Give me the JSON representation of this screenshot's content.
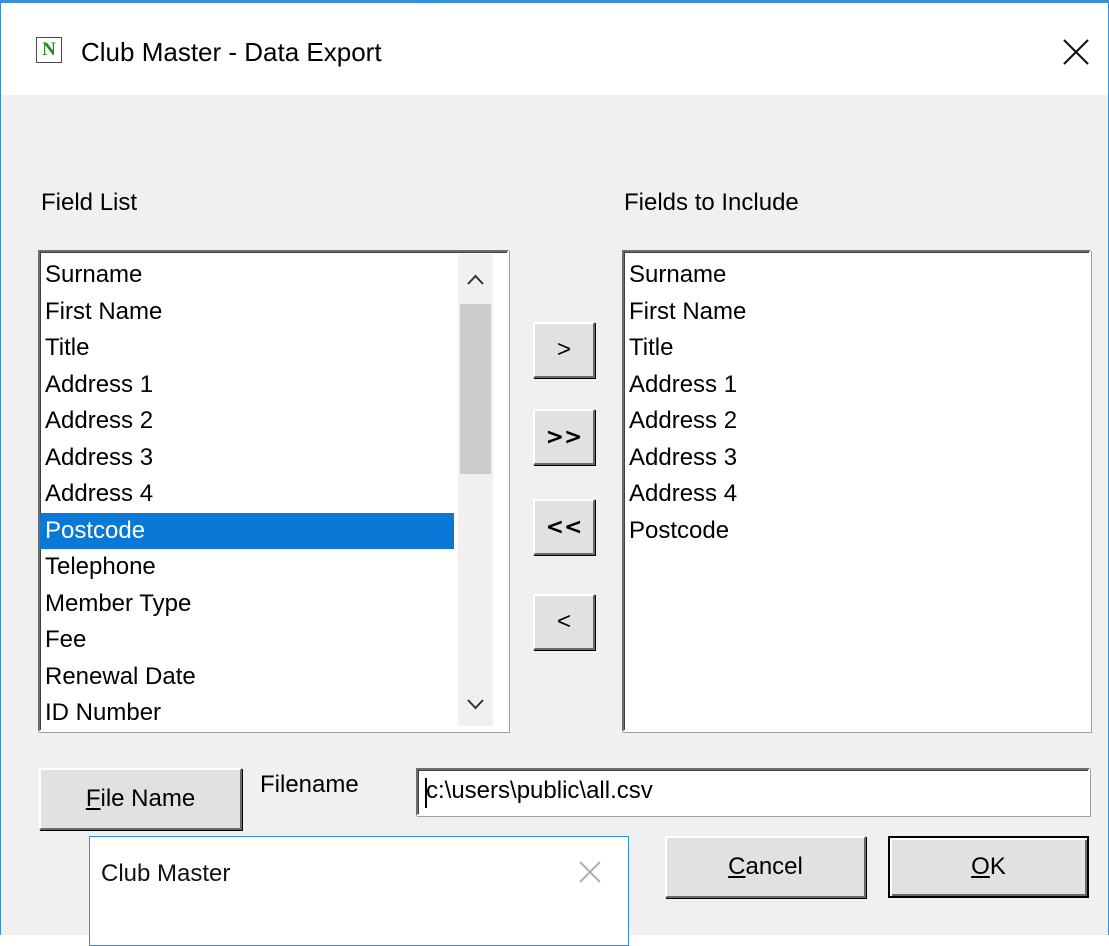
{
  "window": {
    "title": "Club Master - Data Export",
    "app_icon_letter": "N",
    "app_icon": "app-n-icon",
    "close_icon": "close-icon",
    "accent_color": "#3b8fd6"
  },
  "field_list": {
    "label": "Field List",
    "items": [
      "Surname",
      "First Name",
      "Title",
      "Address 1",
      "Address 2",
      "Address 3",
      "Address 4",
      "Postcode",
      "Telephone",
      "Member Type",
      "Fee",
      "Renewal Date",
      "ID Number"
    ],
    "selected_item": "Postcode",
    "selection_color": "#0a78d7",
    "scrollbar": {
      "up_icon": "chevron-up-icon",
      "down_icon": "chevron-down-icon"
    }
  },
  "fields_to_include": {
    "label": "Fields to Include",
    "items": [
      "Surname",
      "First Name",
      "Title",
      "Address 1",
      "Address 2",
      "Address 3",
      "Address 4",
      "Postcode"
    ]
  },
  "move_buttons": {
    "add_one": ">",
    "add_all": ">>",
    "remove_all": "<<",
    "remove_one": "<"
  },
  "file": {
    "button_first": "F",
    "button_rest": "ile Name",
    "label": "Filename",
    "value": "c:\\users\\public\\all.csv"
  },
  "actions": {
    "cancel_first": "C",
    "cancel_rest": "ancel",
    "ok_first": "O",
    "ok_rest": "K"
  },
  "tooltip": {
    "text": "Club Master",
    "close_icon": "close-icon"
  }
}
